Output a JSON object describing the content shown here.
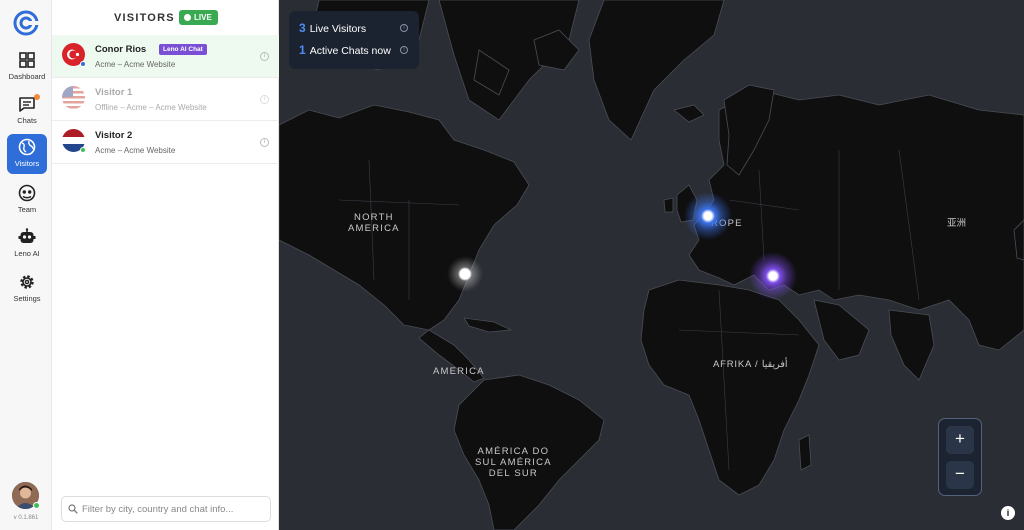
{
  "nav": {
    "items": [
      {
        "label": "Dashboard",
        "icon": "grid-icon"
      },
      {
        "label": "Chats",
        "icon": "chat-icon"
      },
      {
        "label": "Visitors",
        "icon": "globe-icon"
      },
      {
        "label": "Team",
        "icon": "team-icon"
      },
      {
        "label": "Leno AI",
        "icon": "robot-icon"
      },
      {
        "label": "Settings",
        "icon": "gear-icon"
      }
    ],
    "version": "v 0.1.861",
    "accent": "#2f6ed8"
  },
  "panel": {
    "title": "VISITORS",
    "live_label": "LIVE",
    "visitors": [
      {
        "name": "Conor Rios",
        "tag": "Leno AI Chat",
        "subtitle": "Acme – Acme Website",
        "flag": "turkey-flag-icon"
      },
      {
        "name": "Visitor 1",
        "subtitle": "Offline – Acme – Acme Website",
        "flag": "usa-flag-icon"
      },
      {
        "name": "Visitor 2",
        "subtitle": "Acme – Acme Website",
        "flag": "netherlands-flag-icon"
      }
    ],
    "filter_placeholder": "Filter by city, country and chat info..."
  },
  "map": {
    "stats": [
      {
        "count": "3",
        "label": "Live Visitors"
      },
      {
        "count": "1",
        "label": "Active Chats now"
      }
    ],
    "labels": {
      "north_america_1": "NORTH",
      "north_america_2": "AMERICA",
      "europe": "ROPE",
      "asia": "亚洲",
      "america": "AMERICA",
      "africa": "AFRIKA / أفريقيا",
      "south_america_1": "AMÉRICA DO",
      "south_america_2": "SUL AMÉRICA",
      "south_america_3": "DEL SUR"
    },
    "zoom_in": "+",
    "zoom_out": "−",
    "info": "i"
  }
}
